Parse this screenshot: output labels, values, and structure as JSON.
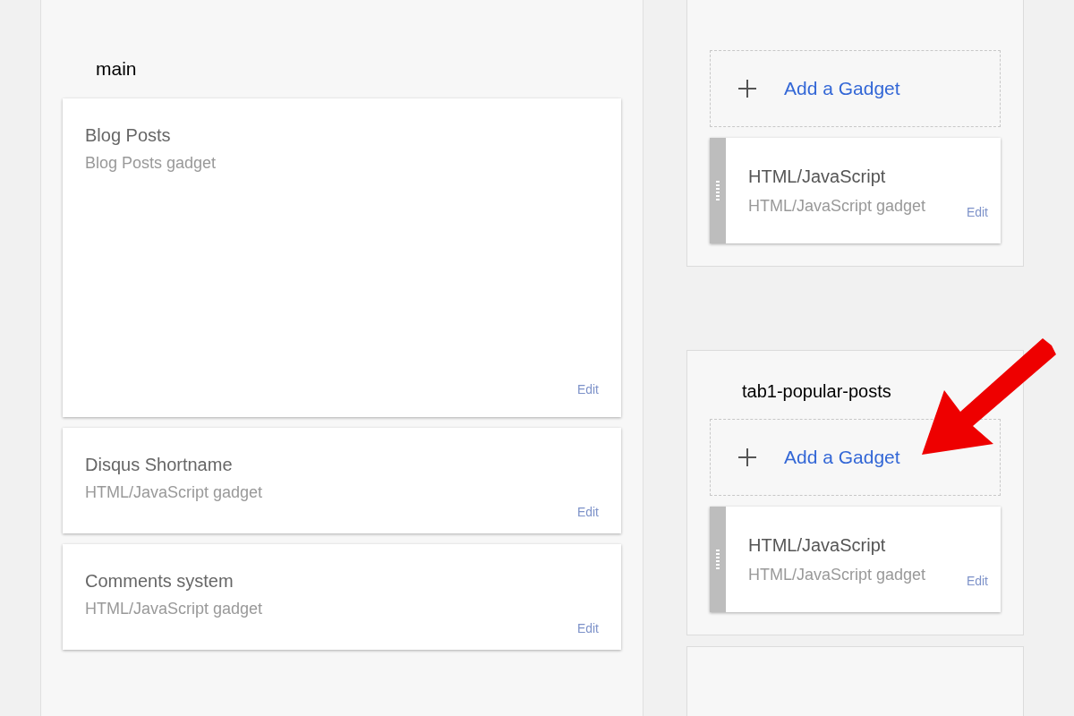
{
  "main": {
    "title": "main",
    "gadgets": [
      {
        "kind": "posts",
        "title": "Blog Posts",
        "subtitle": "Blog Posts gadget",
        "edit": "Edit"
      },
      {
        "kind": "html",
        "title": "Disqus Shortname",
        "subtitle": "HTML/JavaScript gadget",
        "edit": "Edit"
      },
      {
        "kind": "html",
        "title": "Comments system",
        "subtitle": "HTML/JavaScript gadget",
        "edit": "Edit"
      }
    ]
  },
  "sidebar_sections": [
    {
      "add_label": "Add a Gadget",
      "gadgets": [
        {
          "title": "HTML/JavaScript",
          "subtitle": "HTML/JavaScript gadget",
          "edit": "Edit"
        }
      ]
    },
    {
      "title": "tab1-popular-posts",
      "add_label": "Add a Gadget",
      "gadgets": [
        {
          "title": "HTML/JavaScript",
          "subtitle": "HTML/JavaScript gadget",
          "edit": "Edit"
        }
      ]
    }
  ]
}
